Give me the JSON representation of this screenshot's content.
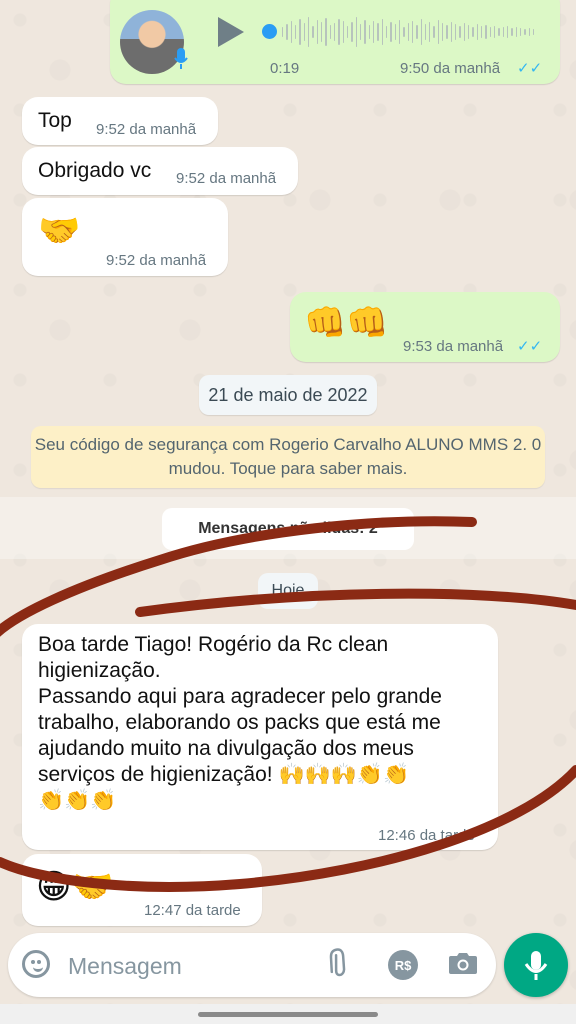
{
  "voice_message": {
    "duration": "0:19",
    "time": "9:50 da manhã",
    "ticks": "✓✓"
  },
  "messages": [
    {
      "text": "Top",
      "time": "9:52 da manhã"
    },
    {
      "text": "Obrigado vc",
      "time": "9:52 da manhã"
    },
    {
      "emoji": "🤝",
      "time": "9:52 da manhã"
    },
    {
      "emoji": "👊👊",
      "time": "9:53 da manhã",
      "ticks": "✓✓"
    }
  ],
  "date_divider": "21 de maio de 2022",
  "security_notice": "Seu código de segurança com Rogerio Carvalho ALUNO MMS 2. 0 mudou. Toque para saber mais.",
  "unread_divider": "Mensagens não lidas: 2",
  "today_divider": "Hoje",
  "long_message": {
    "text": "Boa tarde Tiago! Rogério da Rc clean higienização.\nPassando aqui para agradecer pelo grande trabalho, elaborando os packs que está me ajudando muito na divulgação dos meus serviços de higienização! 🙌🙌🙌👏👏\n👏👏👏",
    "time": "12:46 da tarde"
  },
  "last_message": {
    "emoji": "😁🤝",
    "time": "12:47 da tarde"
  },
  "input": {
    "placeholder": "Mensagem",
    "currency_label": "R$"
  },
  "colors": {
    "outgoing_bubble": "#dcf8c6",
    "incoming_bubble": "#ffffff",
    "read_ticks": "#34b7f1",
    "send_button": "#00a884",
    "scribble": "#8b2a14"
  }
}
